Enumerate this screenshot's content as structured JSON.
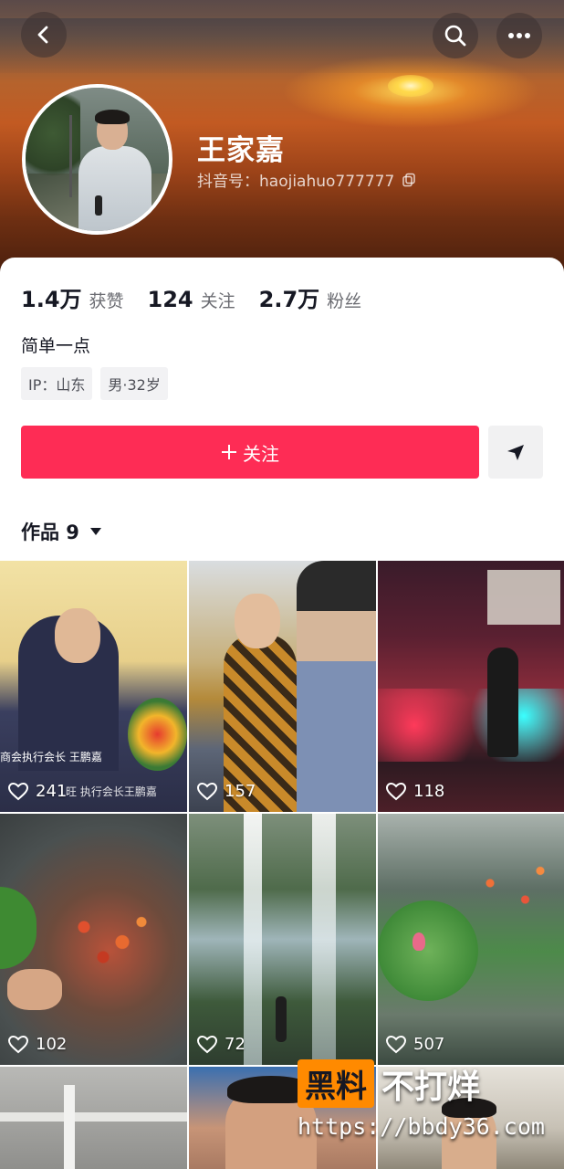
{
  "header": {
    "name": "王家嘉",
    "douyin_id": "抖音号：haojiahuo777777",
    "icons": [
      "back-icon",
      "search-icon",
      "more-icon",
      "copy-icon"
    ]
  },
  "stats": [
    {
      "num": "1.4万",
      "label": "获赞"
    },
    {
      "num": "124",
      "label": "关注"
    },
    {
      "num": "2.7万",
      "label": "粉丝"
    }
  ],
  "bio": "简单一点",
  "tags": [
    "IP：山东",
    "男·32岁"
  ],
  "actions": {
    "follow_label": "关注",
    "follow_color": "#fe2c55"
  },
  "works": {
    "label": "作品 9"
  },
  "grid": [
    {
      "likes": "241",
      "caption": "商会执行会长 王鹏嘉",
      "caption2": "旺 执行会长王鹏嘉"
    },
    {
      "likes": "157"
    },
    {
      "likes": "118"
    },
    {
      "likes": "102"
    },
    {
      "likes": "72"
    },
    {
      "likes": "507"
    }
  ],
  "watermark": {
    "brand": "黑料",
    "tagline": "不打烊",
    "url": "https://bbdy36.com",
    "brand_color": "#ff8a00"
  }
}
